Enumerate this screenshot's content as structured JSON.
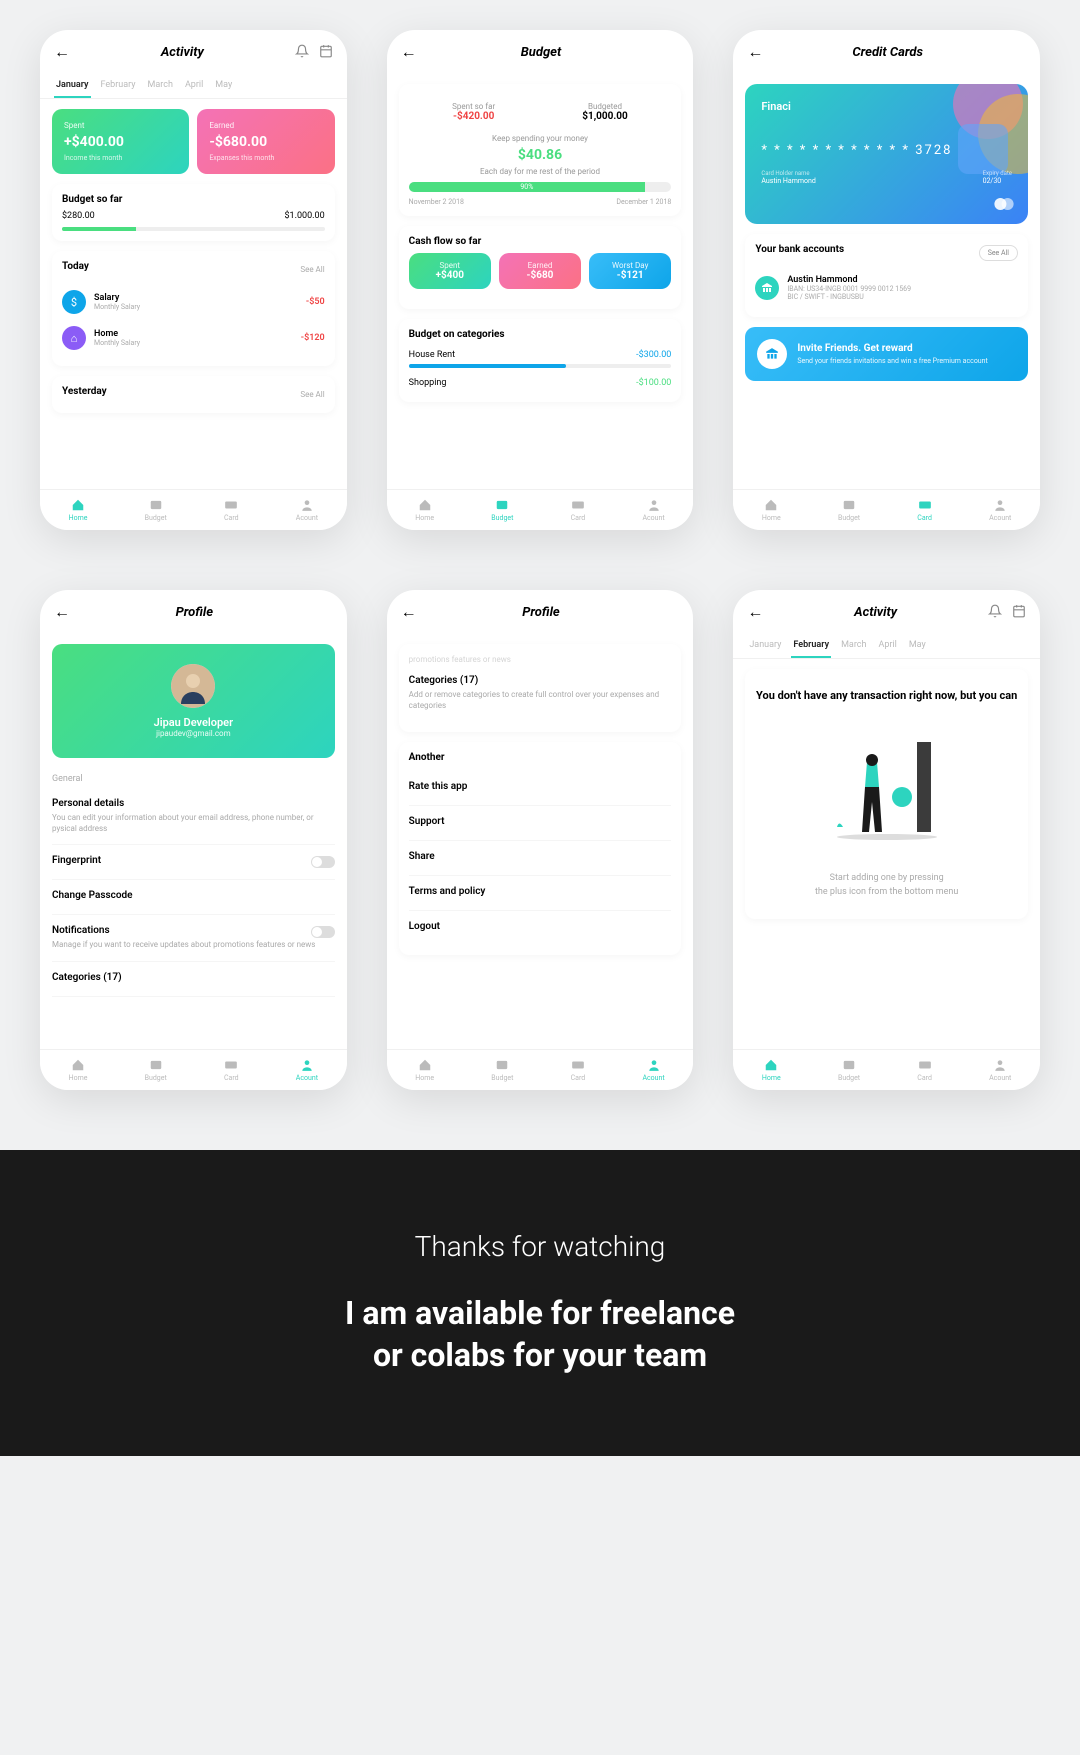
{
  "nav": {
    "home": "Home",
    "budget": "Budget",
    "card": "Card",
    "account": "Acount"
  },
  "months": [
    "January",
    "February",
    "March",
    "April",
    "May"
  ],
  "screen1": {
    "title": "Activity",
    "spent": {
      "label": "Spent",
      "value": "+$400.00",
      "sub": "Income this month"
    },
    "earned": {
      "label": "Earned",
      "value": "-$680.00",
      "sub": "Expanses this month"
    },
    "budgetTitle": "Budget so far",
    "budgetLeft": "$280.00",
    "budgetRight": "$1.000.00",
    "today": "Today",
    "seeAll": "See All",
    "yesterday": "Yesterday",
    "salary": {
      "title": "Salary",
      "sub": "Monthly Salary",
      "amt": "-$50"
    },
    "home": {
      "title": "Home",
      "sub": "Monthly Salary",
      "amt": "-$120"
    }
  },
  "screen2": {
    "title": "Budget",
    "spentLabel": "Spent so far",
    "spentVal": "-$420.00",
    "budgetedLabel": "Budgeted",
    "budgetedVal": "$1,000.00",
    "keepSpending": "Keep spending your money",
    "daily": "$40.86",
    "eachDay": "Each day for me rest of the period",
    "progress": "90%",
    "dateStart": "November 2 2018",
    "dateEnd": "December 1 2018",
    "cashTitle": "Cash flow so far",
    "cards": {
      "spent": {
        "l": "Spent",
        "v": "+$400"
      },
      "earned": {
        "l": "Earned",
        "v": "-$680"
      },
      "worst": {
        "l": "Worst Day",
        "v": "-$121"
      }
    },
    "catTitle": "Budget on categories",
    "rent": {
      "l": "House Rent",
      "v": "-$300.00"
    },
    "shopping": {
      "l": "Shopping",
      "v": "-$100.00"
    }
  },
  "screen3": {
    "title": "Credit Cards",
    "brand": "Finaci",
    "number": "* * * *   * * * *   * * * *   3728",
    "holderLabel": "Card Holder name",
    "holder": "Austin Hammond",
    "expLabel": "Expiry date",
    "exp": "02/30",
    "bankTitle": "Your bank accounts",
    "seeAll": "See All",
    "acctName": "Austin Hammond",
    "iban": "IBAN: US34-INGB 0001 9999 0012 1569",
    "bic": "BIC / SWIFT - INGBUSBU",
    "inviteTitle": "Invite Friends. Get reward",
    "inviteDesc": "Send your friends invitations and win a free Premium account"
  },
  "screen4": {
    "title": "Profile",
    "name": "Jipau Developer",
    "email": "jipaudev@gmail.com",
    "general": "General",
    "personal": "Personal details",
    "personalDesc": "You can edit your information about your email address, phone number, or pysical address",
    "fingerprint": "Fingerprint",
    "passcode": "Change Passcode",
    "notifications": "Notifications",
    "notifDesc": "Manage if you want to receive updates about promotions features or news",
    "categories": "Categories (17)"
  },
  "screen5": {
    "title": "Profile",
    "topDesc": "promotions features or news",
    "categories": "Categories (17)",
    "catDesc": "Add or remove categories to create full control over your expenses and categories",
    "another": "Another",
    "rate": "Rate this app",
    "support": "Support",
    "share": "Share",
    "terms": "Terms and policy",
    "logout": "Logout"
  },
  "screen6": {
    "title": "Activity",
    "emptyTitle": "You don't have any transaction right now, but you can",
    "emptyDesc1": "Start adding one by pressing",
    "emptyDesc2": "the plus icon from the bottom menu"
  },
  "footer": {
    "thanks": "Thanks for watching",
    "avail1": "I am available for freelance",
    "avail2": "or colabs for your team"
  }
}
